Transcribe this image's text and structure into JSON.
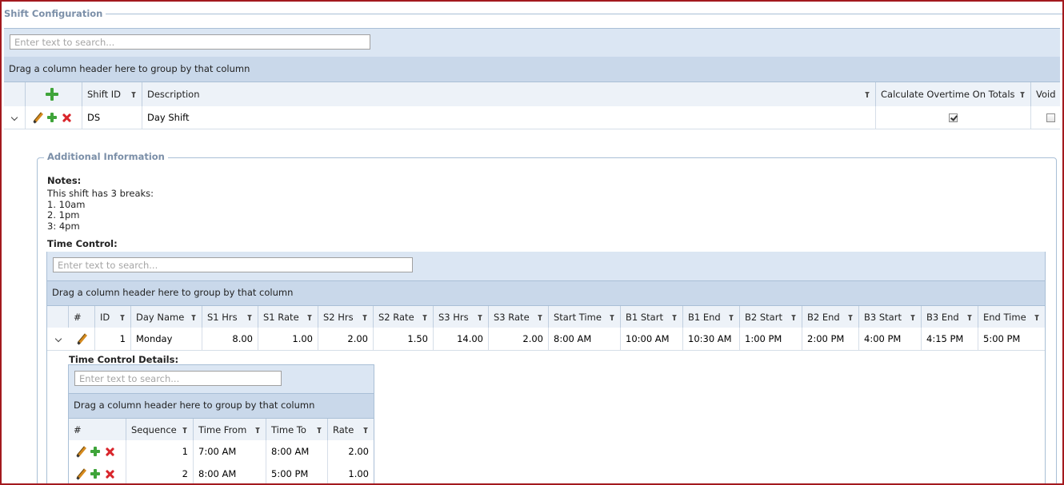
{
  "section_title": "Shift Configuration",
  "search_placeholder": "Enter text to search...",
  "group_hint": "Drag a column header here to group by that column",
  "shift_grid": {
    "columns": [
      "Shift ID",
      "Description",
      "Calculate Overtime On Totals",
      "Void"
    ],
    "row": {
      "shift_id": "DS",
      "description": "Day Shift",
      "calc_overtime": true,
      "void": false
    }
  },
  "additional_info": {
    "legend": "Additional Information",
    "notes_label": "Notes:",
    "notes_text": "This shift has 3 breaks:\n1. 10am\n2. 1pm\n3: 4pm",
    "time_control_label": "Time Control:"
  },
  "time_control_grid": {
    "columns": [
      "#",
      "ID",
      "Day Name",
      "S1 Hrs",
      "S1 Rate",
      "S2 Hrs",
      "S2 Rate",
      "S3 Hrs",
      "S3 Rate",
      "Start Time",
      "B1 Start",
      "B1 End",
      "B2 Start",
      "B2 End",
      "B3 Start",
      "B3 End",
      "End Time"
    ],
    "row": [
      "1",
      "Monday",
      "8.00",
      "1.00",
      "2.00",
      "1.50",
      "14.00",
      "2.00",
      "8:00 AM",
      "10:00 AM",
      "10:30 AM",
      "1:00 PM",
      "2:00 PM",
      "4:00 PM",
      "4:15 PM",
      "5:00 PM"
    ]
  },
  "details": {
    "label": "Time Control Details:",
    "columns": [
      "#",
      "Sequence",
      "Time From",
      "Time To",
      "Rate"
    ],
    "rows": [
      [
        "1",
        "7:00 AM",
        "8:00 AM",
        "2.00"
      ],
      [
        "2",
        "8:00 AM",
        "5:00 PM",
        "1.00"
      ]
    ]
  }
}
